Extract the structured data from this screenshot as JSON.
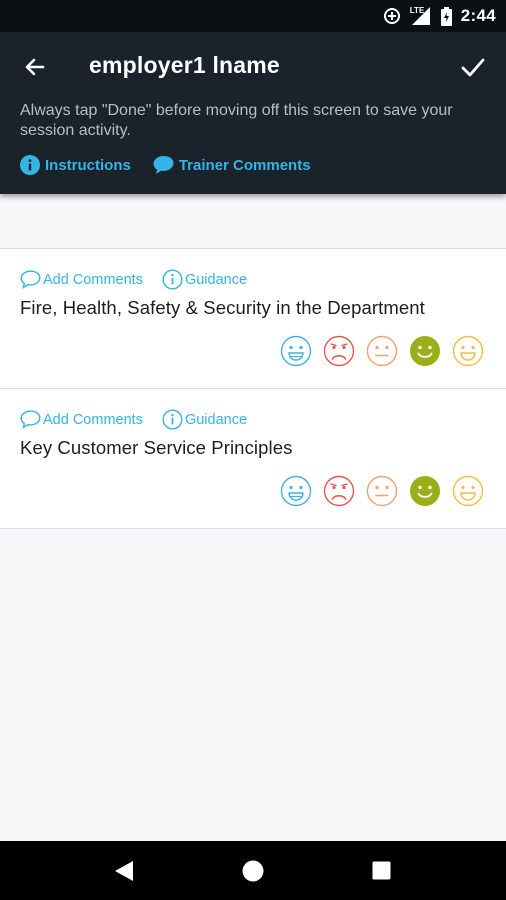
{
  "status_bar": {
    "time": "2:44",
    "network_label": "LTE",
    "icons": [
      "data-saver-icon",
      "signal-icon",
      "battery-icon"
    ]
  },
  "header": {
    "title": "employer1 lname",
    "notice": "Always tap \"Done\" before moving off this screen to save your session activity.",
    "links": [
      {
        "label": "Instructions",
        "icon": "info-icon"
      },
      {
        "label": "Trainer Comments",
        "icon": "comment-icon"
      }
    ]
  },
  "cards": [
    {
      "title": "Fire, Health, Safety & Security in the Department",
      "add_comments_label": "Add Comments",
      "guidance_label": "Guidance",
      "selected_rating": "satisfied"
    },
    {
      "title": "Key Customer Service Principles",
      "add_comments_label": "Add Comments",
      "guidance_label": "Guidance",
      "selected_rating": "satisfied"
    }
  ],
  "rating_faces": [
    {
      "name": "excellent",
      "color": "#3fb3dd"
    },
    {
      "name": "poor",
      "color": "#e2584d"
    },
    {
      "name": "neutral",
      "color": "#f2a070"
    },
    {
      "name": "satisfied",
      "color": "#9aae18"
    },
    {
      "name": "good",
      "color": "#f4bb45"
    }
  ],
  "colors": {
    "accent": "#33b5e5",
    "header_bg": "#1a222b",
    "status_bg": "#0b1015",
    "selected_face": "#9aae18"
  }
}
